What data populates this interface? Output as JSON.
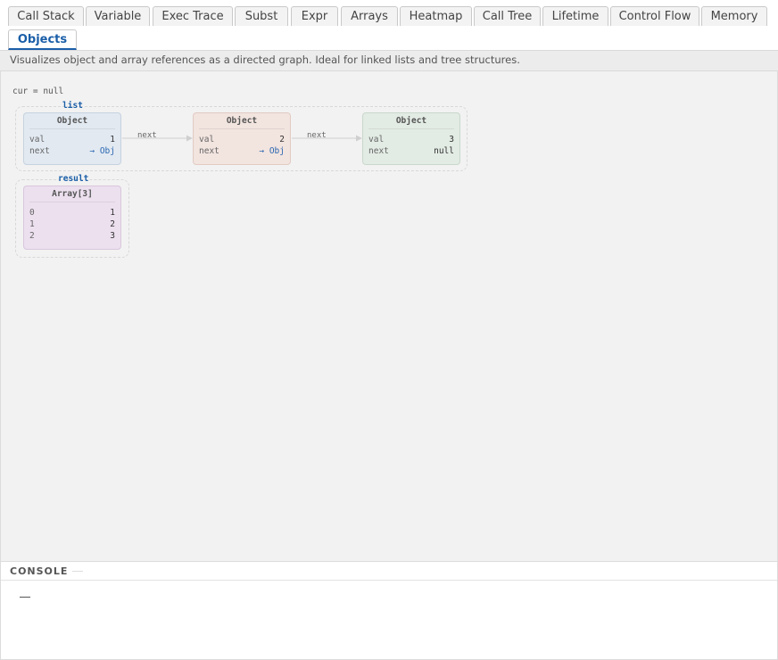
{
  "tabs": [
    {
      "label": "Call Stack"
    },
    {
      "label": "Variable"
    },
    {
      "label": "Exec Trace"
    },
    {
      "label": "Subst"
    },
    {
      "label": "Expr"
    },
    {
      "label": "Arrays"
    },
    {
      "label": "Heatmap"
    },
    {
      "label": "Call Tree"
    },
    {
      "label": "Lifetime"
    },
    {
      "label": "Control Flow"
    },
    {
      "label": "Memory"
    },
    {
      "label": "Objects"
    }
  ],
  "active_tab": "Objects",
  "description": "Visualizes object and array references as a directed graph. Ideal for linked lists and tree structures.",
  "graph": {
    "cur_text": "cur = null",
    "groups": [
      {
        "label": "list"
      },
      {
        "label": "result"
      }
    ],
    "nodes": [
      {
        "title": "Object",
        "rows": [
          {
            "key": "val",
            "value": "1"
          },
          {
            "key": "next",
            "value": "→ Obj"
          }
        ]
      },
      {
        "title": "Object",
        "rows": [
          {
            "key": "val",
            "value": "2"
          },
          {
            "key": "next",
            "value": "→ Obj"
          }
        ]
      },
      {
        "title": "Object",
        "rows": [
          {
            "key": "val",
            "value": "3"
          },
          {
            "key": "next",
            "value": "null"
          }
        ]
      },
      {
        "title": "Array[3]",
        "rows": [
          {
            "key": "0",
            "value": "1"
          },
          {
            "key": "1",
            "value": "2"
          },
          {
            "key": "2",
            "value": "3"
          }
        ]
      }
    ],
    "edges": [
      {
        "label": "next"
      },
      {
        "label": "next"
      }
    ]
  },
  "console": {
    "title": "CONSOLE"
  },
  "colors": {
    "accent": "#1a5ea8",
    "node_blue": "#e2e9f1",
    "node_red": "#f2e4df",
    "node_green": "#e2ebe4",
    "node_purple": "#ece0ef"
  }
}
